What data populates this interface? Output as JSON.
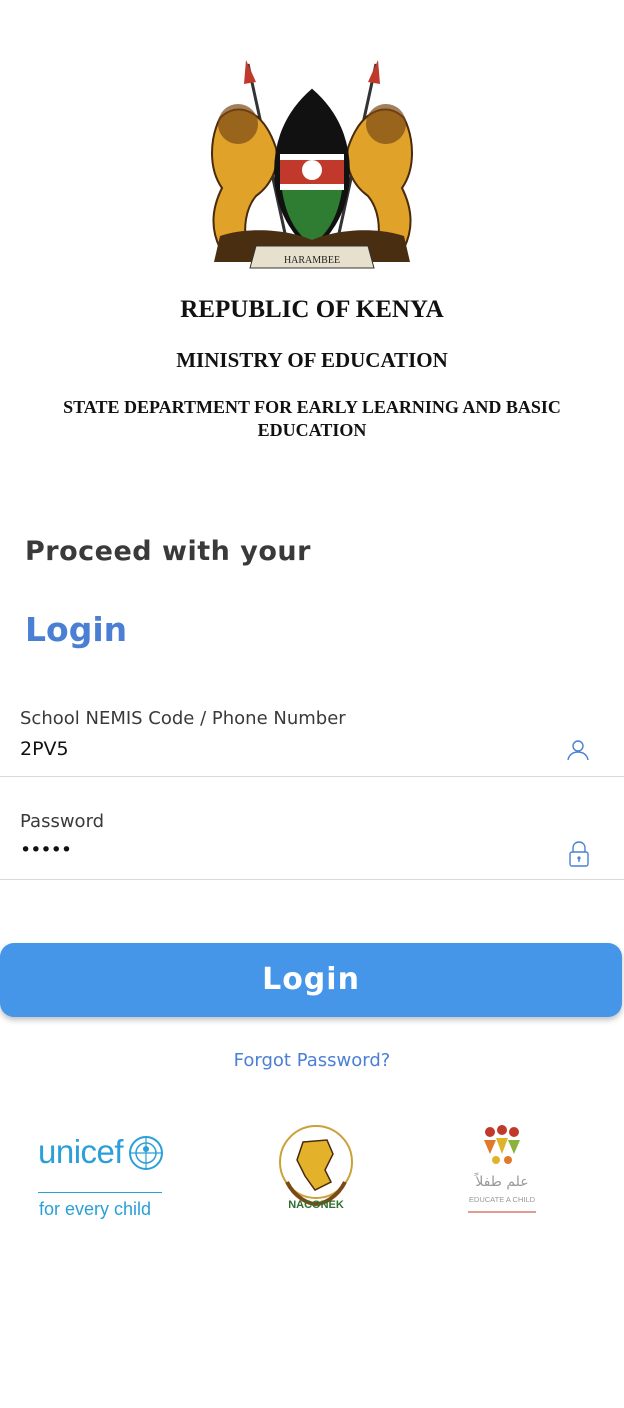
{
  "header": {
    "country": "REPUBLIC OF KENYA",
    "ministry": "MINISTRY OF EDUCATION",
    "department": "STATE DEPARTMENT FOR EARLY LEARNING AND BASIC EDUCATION",
    "coat_of_arms_motto": "HARAMBEE"
  },
  "intro": {
    "subtitle": "Proceed with your",
    "title": "Login"
  },
  "form": {
    "username": {
      "label": "School NEMIS Code / Phone Number",
      "value": "2PV5",
      "icon": "user-icon"
    },
    "password": {
      "label": "Password",
      "value": "•••••",
      "icon": "lock-icon"
    },
    "submit_label": "Login",
    "forgot_label": "Forgot Password?"
  },
  "partners": {
    "unicef": {
      "name": "unicef",
      "tagline": "for every child"
    },
    "naconek": {
      "name": "NACONEK"
    },
    "educate_a_child": {
      "name": "EDUCATE A CHILD",
      "arabic": "علم طفلاً"
    }
  },
  "colors": {
    "accent": "#4a7fd4",
    "button": "#4595e9",
    "unicef_blue": "#2a9fd8"
  }
}
